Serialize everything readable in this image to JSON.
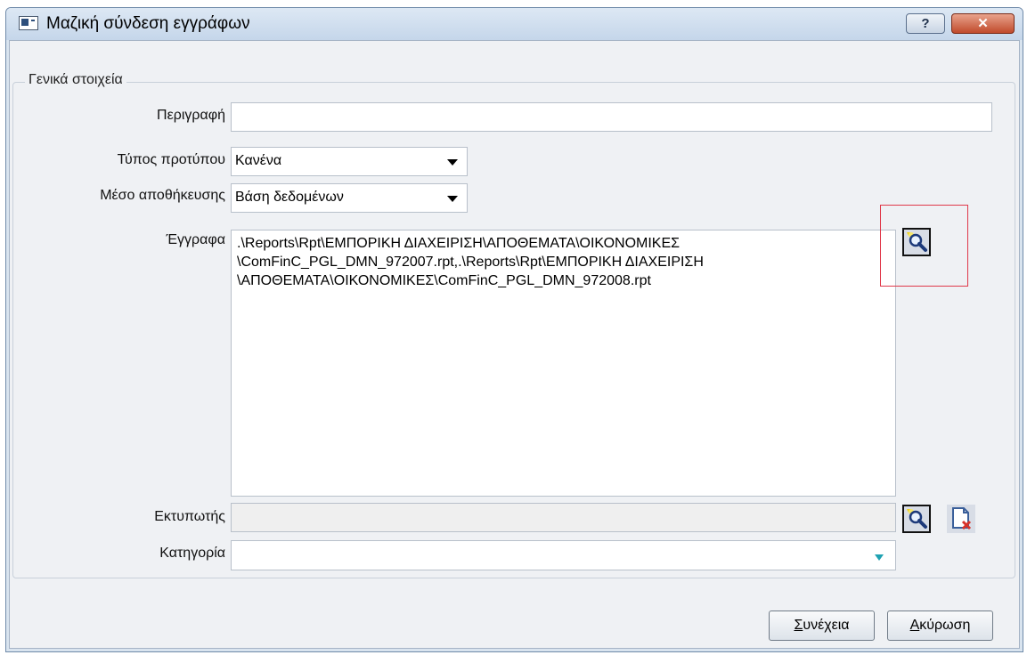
{
  "window": {
    "title": "Μαζική σύνδεση εγγράφων",
    "help_label": "?",
    "close_label": "✕"
  },
  "group": {
    "legend": "Γενικά στοιχεία"
  },
  "fields": {
    "description": {
      "label": "Περιγραφή",
      "value": ""
    },
    "template_type": {
      "label": "Τύπος προτύπου",
      "value": "Κανένα"
    },
    "storage_medium": {
      "label": "Μέσο αποθήκευσης",
      "value": "Βάση δεδομένων"
    },
    "documents": {
      "label": "Έγγραφα",
      "value": ".\\Reports\\Rpt\\ΕΜΠΟΡΙΚΗ ΔΙΑΧΕΙΡΙΣΗ\\ΑΠΟΘΕΜΑΤΑ\\ΟΙΚΟΝΟΜΙΚΕΣ\n\\ComFinC_PGL_DMN_972007.rpt,.\\Reports\\Rpt\\ΕΜΠΟΡΙΚΗ ΔΙΑΧΕΙΡΙΣΗ\n\\ΑΠΟΘΕΜΑΤΑ\\ΟΙΚΟΝΟΜΙΚΕΣ\\ComFinC_PGL_DMN_972008.rpt"
    },
    "printer": {
      "label": "Εκτυπωτής",
      "value": ""
    },
    "category": {
      "label": "Κατηγορία",
      "value": ""
    }
  },
  "buttons": {
    "continue": {
      "mnemonic": "Σ",
      "rest": "υνέχεια"
    },
    "cancel": {
      "mnemonic": "Α",
      "rest": "κύρωση"
    }
  },
  "icons": {
    "browse": "browse-search-icon",
    "clear": "clear-document-icon"
  },
  "colors": {
    "highlight": "#e0394a",
    "close_button": "#c04a2b",
    "category_arrow": "#1fa2b2"
  }
}
